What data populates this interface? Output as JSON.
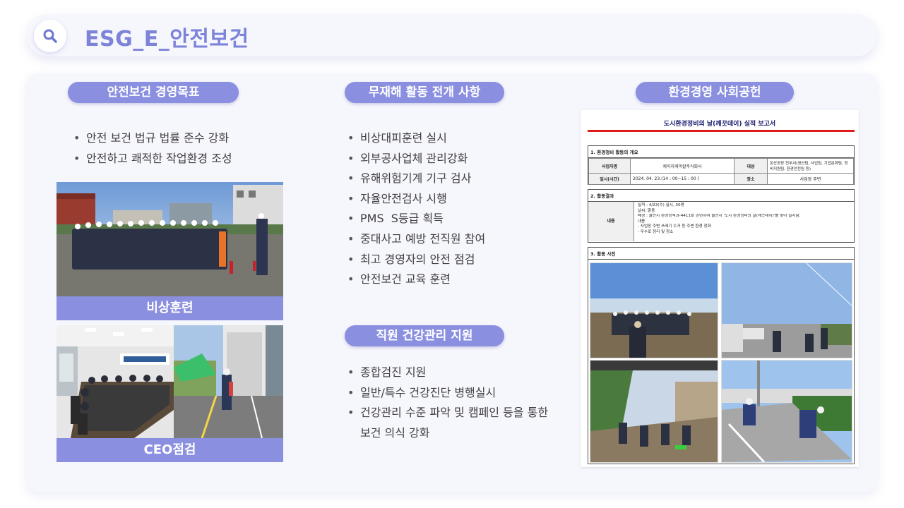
{
  "header": {
    "title": "ESG_E_안전보건"
  },
  "sections": {
    "left": {
      "title": "안전보건 경영목표",
      "bullets": [
        "안전 보건 법규 법률 준수 강화",
        "안전하고 쾌적한 작업환경 조성"
      ],
      "photo1_caption": "비상훈련",
      "photo2_caption": "CEO점검"
    },
    "middle": {
      "title": "무재해 활동 전개 사항",
      "bullets": [
        "비상대피훈련 실시",
        "외부공사업체 관리강화",
        "유해위험기계 기구 검사",
        "자율안전검사 시행",
        "PMS  S등급 획득",
        "중대사고 예방 전직원 참여",
        "최고 경영자의 안전 점검",
        "안전보건 교육 훈련"
      ],
      "health_title": "직원 건강관리 지원",
      "health_bullets": [
        "종합검진 지원",
        "일반/특수 건강진단 병행실시",
        "건강관리 수준 파악 및 캠페인 등을 통한",
        "보건 의식 강화"
      ]
    },
    "right": {
      "title": "환경경영 사회공헌"
    }
  },
  "report": {
    "title": "도시환경정비의 날(깨끗데이) 실적 보고서",
    "sec1_title": "1. 환경정비 활동의 개요",
    "row1": [
      "사업자명",
      "케이지케미칼주식회사",
      "대상",
      "온산공장 전부서(생산팀, 사업팀, 기업문화팀, 정비지원팀, 환경안전팀 등)"
    ],
    "row2": [
      "일시(시간)",
      "2024. 04. 23.(14 : 00~15 : 00 )",
      "장소",
      "사업장 주변"
    ],
    "sec2_title": "2. 활동결과",
    "content_label": "내용",
    "content_lines": [
      "실적 : 4/23(수) 실시, 30명",
      "날씨: 맑음",
      "배경 : 울산시 환경정책과-4411호 관련하여 울산시 '도시 환경정비의 날(깨끗데이)'를 맞아 실시함.",
      "내용",
      "- 사업장 주변 쓰레기 수거 등 주변 환경 정화",
      "- 우수로 정리 및 청소"
    ],
    "sec3_title": "3. 활동 사진"
  },
  "colors": {
    "accent": "#8a8fe0",
    "title": "#7c83d8",
    "panel": "#f6f6fd",
    "report_line": "#e01b1b"
  },
  "icons": {
    "header": "search-icon"
  }
}
